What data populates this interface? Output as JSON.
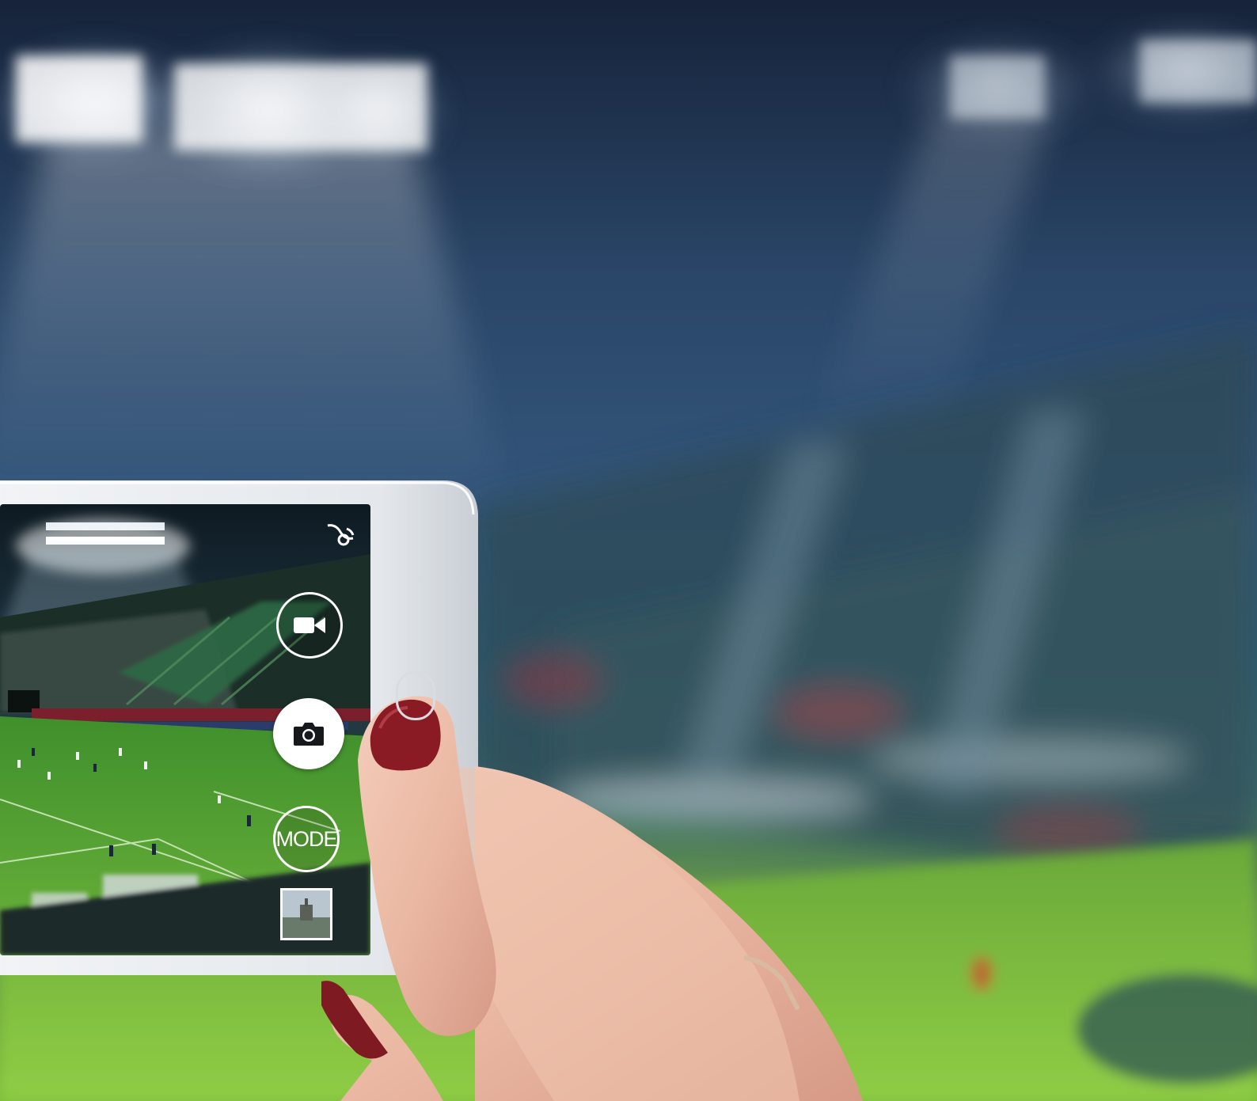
{
  "scene": {
    "description_colors": {
      "sky": "#1d3a60",
      "field": "#7fbf3a",
      "phone_body": "#e7eaed",
      "nail": "#8c1b23"
    }
  },
  "camera_ui": {
    "icons": [
      "video-camera-icon",
      "camera-icon",
      "settings-icon"
    ],
    "mode_label": "MODE"
  }
}
